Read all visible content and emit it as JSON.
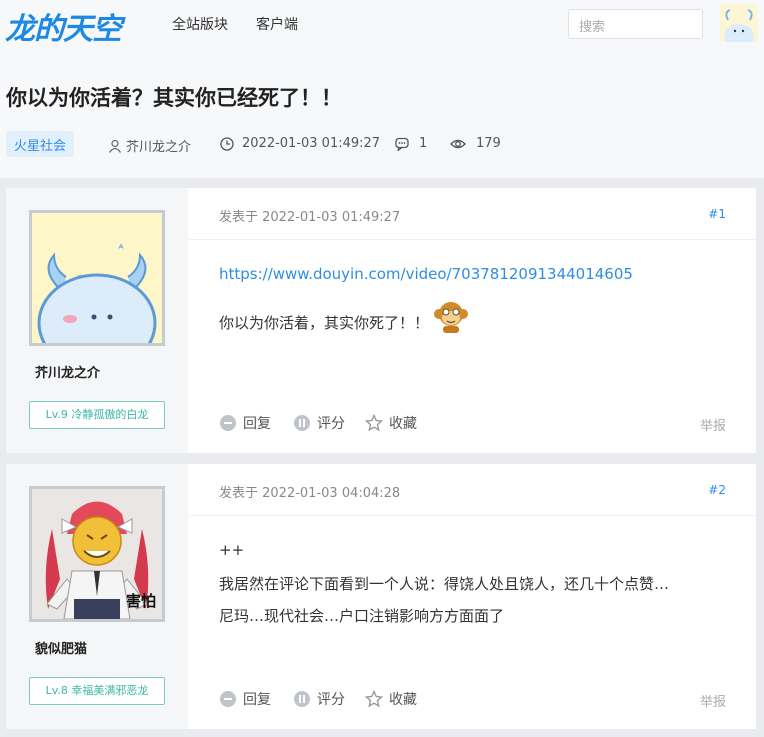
{
  "header": {
    "logo": "龙的天空",
    "nav": [
      "全站版块",
      "客户端"
    ],
    "search_placeholder": "搜索"
  },
  "thread": {
    "title": "你以为你活着？其实你已经死了！！",
    "forum": "火星社会",
    "author": "芥川龙之介",
    "datetime": "2022-01-03 01:49:27",
    "replies": "1",
    "views": "179"
  },
  "posts": [
    {
      "username": "芥川龙之介",
      "level": "Lv.9 冷静孤傲的白龙",
      "time": "发表于 2022-01-03 01:49:27",
      "floor": "#1",
      "lines": [
        "https://www.douyin.com/video/7037812091344014605",
        "你以为你活着，其实你死了！！"
      ]
    },
    {
      "username": "貌似肥猫",
      "level": "Lv.8 幸福美满邪恶龙",
      "time": "发表于 2022-01-03 04:04:28",
      "floor": "#2",
      "avatar_caption": "害怕",
      "lines": [
        "++",
        "我居然在评论下面看到一个人说：得饶人处且饶人，还几十个点赞…",
        "尼玛…现代社会…户口注销影响方方面面了"
      ]
    }
  ],
  "actions": {
    "reply": "回复",
    "rate": "评分",
    "favorite": "收藏",
    "report": "举报"
  },
  "colors": {
    "accent": "#1e88e5",
    "link": "#2f8de4",
    "level_badge": "#3cb8a6"
  }
}
